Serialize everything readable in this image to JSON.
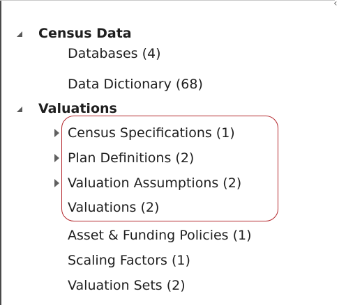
{
  "tree": {
    "groups": [
      {
        "label": "Census Data",
        "expanded": true,
        "children": [
          {
            "label": "Databases (4)"
          },
          {
            "label": "Data Dictionary (68)"
          }
        ]
      },
      {
        "label": "Valuations",
        "expanded": true,
        "children": [
          {
            "label": "Census Specifications (1)",
            "has_children": true
          },
          {
            "label": "Plan Definitions (2)",
            "has_children": true
          },
          {
            "label": "Valuation Assumptions (2)",
            "has_children": true
          },
          {
            "label": "Valuations (2)"
          },
          {
            "label": "Asset & Funding Policies (1)"
          },
          {
            "label": "Scaling Factors (1)"
          },
          {
            "label": "Valuation Sets (2)"
          }
        ]
      }
    ]
  },
  "colors": {
    "highlight_border": "#b3262b",
    "text": "#1e1e1e",
    "icon": "#5a5a5a"
  },
  "icons": {
    "expanded": "triangle-expanded-icon",
    "collapsed": "triangle-collapsed-icon",
    "panel_collapse": "chevron-left-icon"
  }
}
